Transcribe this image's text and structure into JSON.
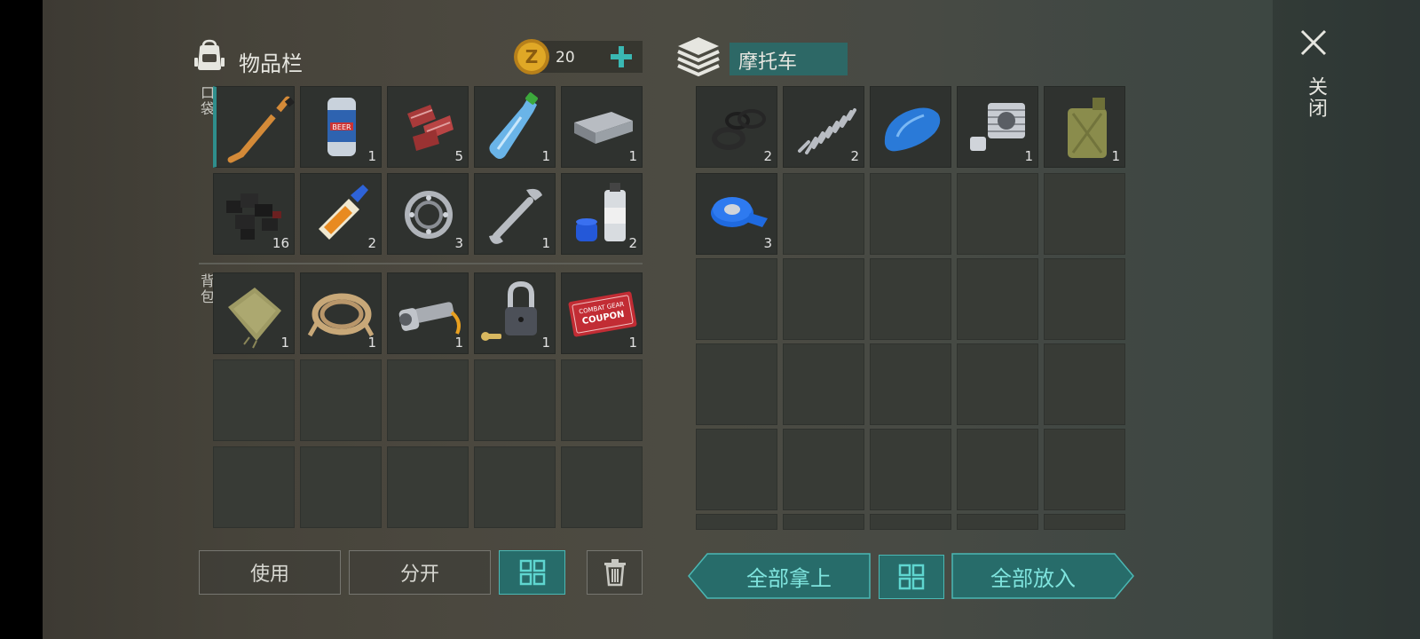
{
  "colors": {
    "accent_teal": "#276c6a",
    "accent_teal_bright": "#3ab8b3",
    "slot_filled": "#2f322f",
    "slot_empty": "#383b36",
    "coin_gold": "#e0a826"
  },
  "inventory": {
    "title": "物品栏",
    "icon": "backpack-icon",
    "coins": "20",
    "add_icon": "plus-icon",
    "section_pocket": "口袋",
    "section_backpack": "背包",
    "pocket_items": [
      {
        "name": "hockey-stick",
        "icon": "hockey-stick-icon",
        "qty": ""
      },
      {
        "name": "beer-can",
        "icon": "beer-can-icon",
        "qty": "1"
      },
      {
        "name": "raw-meat",
        "icon": "raw-meat-icon",
        "qty": "5"
      },
      {
        "name": "water-bottle",
        "icon": "water-bottle-icon",
        "qty": "1"
      },
      {
        "name": "metal-ingot",
        "icon": "metal-ingot-icon",
        "qty": "1"
      },
      {
        "name": "charcoal",
        "icon": "charcoal-icon",
        "qty": "16"
      },
      {
        "name": "glue",
        "icon": "glue-icon",
        "qty": "2"
      },
      {
        "name": "bearing",
        "icon": "bearing-icon",
        "qty": "3"
      },
      {
        "name": "wrench",
        "icon": "wrench-icon",
        "qty": "1"
      },
      {
        "name": "spray-paint",
        "icon": "spray-paint-icon",
        "qty": "2"
      }
    ],
    "backpack_items": [
      {
        "name": "cloth",
        "icon": "cloth-icon",
        "qty": "1"
      },
      {
        "name": "rope",
        "icon": "rope-icon",
        "qty": "1"
      },
      {
        "name": "flashlight",
        "icon": "flashlight-icon",
        "qty": "1"
      },
      {
        "name": "padlock",
        "icon": "padlock-icon",
        "qty": "1"
      },
      {
        "name": "coupon",
        "icon": "coupon-icon",
        "qty": "1",
        "text_line1": "COMBAT GEAR",
        "text_line2": "COUPON"
      }
    ],
    "buttons": {
      "use": "使用",
      "split": "分开",
      "sort_icon": "grid-sort-icon",
      "trash_icon": "trash-icon"
    }
  },
  "vehicle": {
    "title": "摩托车",
    "icon": "storage-box-icon",
    "items": [
      {
        "name": "gaskets",
        "icon": "gasket-icon",
        "qty": "2"
      },
      {
        "name": "spring",
        "icon": "spring-icon",
        "qty": "2"
      },
      {
        "name": "fuel-tank",
        "icon": "fuel-tank-icon",
        "qty": ""
      },
      {
        "name": "engine-cylinder",
        "icon": "cylinder-icon",
        "qty": "1"
      },
      {
        "name": "jerrycan",
        "icon": "jerrycan-icon",
        "qty": "1"
      },
      {
        "name": "duct-tape",
        "icon": "tape-icon",
        "qty": "3"
      }
    ],
    "buttons": {
      "take_all": "全部拿上",
      "sort_icon": "grid-sort-icon",
      "put_all": "全部放入"
    }
  },
  "close": {
    "label": "关闭",
    "icon": "close-icon"
  }
}
